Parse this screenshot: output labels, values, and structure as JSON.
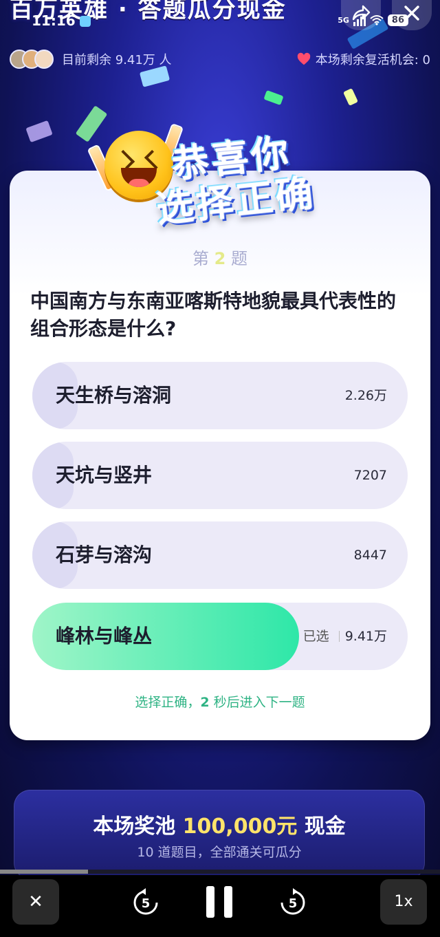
{
  "header": {
    "banner_title": "百万英雄 · 答题瓜分现金",
    "status_time": "11:16",
    "network": "5G",
    "battery": "86"
  },
  "info": {
    "remaining_players": "目前剩余 9.41万 人",
    "revive_chances": "本场剩余复活机会: 0"
  },
  "result": {
    "line1": "恭喜你",
    "line2": "选择正确"
  },
  "question": {
    "number_prefix": "第",
    "number": "2",
    "number_suffix": "题",
    "text": "中国南方与东南亚喀斯特地貌最具代表性的组合形态是什么?",
    "options": [
      {
        "label": "天生桥与溶洞",
        "count": "2.26万",
        "selected": false,
        "share": 0.12
      },
      {
        "label": "天坑与竖井",
        "count": "7207",
        "selected": false,
        "share": 0.11
      },
      {
        "label": "石芽与溶沟",
        "count": "8447",
        "selected": false,
        "share": 0.12
      },
      {
        "label": "峰林与峰丛",
        "count": "9.41万",
        "selected": true,
        "selected_label": "已选",
        "share": 0.71
      }
    ],
    "hint_prefix": "选择正确，",
    "hint_seconds": "2",
    "hint_suffix": " 秒后进入下一题"
  },
  "pool": {
    "prefix": "本场奖池 ",
    "amount": "100,000元",
    "suffix": " 现金",
    "subtitle": "10 道题目，全部通关可瓜分"
  },
  "player": {
    "close_label": "✕",
    "rewind_label": "5",
    "forward_label": "5",
    "speed_label": "1x",
    "progress": 0.2
  },
  "colors": {
    "correct_fill_start": "#9ff5c8",
    "correct_fill_end": "#2ee7a8",
    "option_bg": "#eceaf8",
    "option_fill": "#dddbf3"
  }
}
